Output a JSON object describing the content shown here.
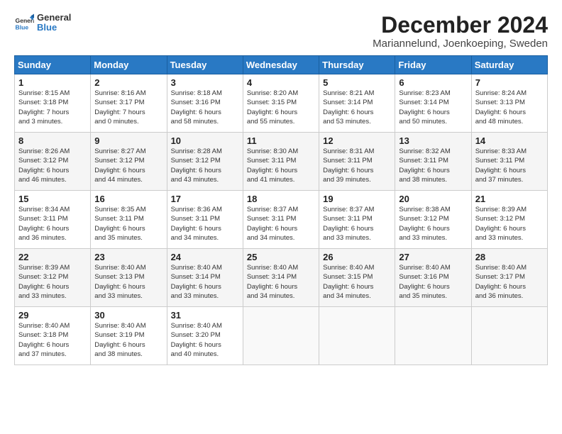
{
  "logo": {
    "line1": "General",
    "line2": "Blue"
  },
  "title": "December 2024",
  "subtitle": "Mariannelund, Joenkoeping, Sweden",
  "days_of_week": [
    "Sunday",
    "Monday",
    "Tuesday",
    "Wednesday",
    "Thursday",
    "Friday",
    "Saturday"
  ],
  "weeks": [
    [
      {
        "day": "1",
        "info": "Sunrise: 8:15 AM\nSunset: 3:18 PM\nDaylight: 7 hours\nand 3 minutes."
      },
      {
        "day": "2",
        "info": "Sunrise: 8:16 AM\nSunset: 3:17 PM\nDaylight: 7 hours\nand 0 minutes."
      },
      {
        "day": "3",
        "info": "Sunrise: 8:18 AM\nSunset: 3:16 PM\nDaylight: 6 hours\nand 58 minutes."
      },
      {
        "day": "4",
        "info": "Sunrise: 8:20 AM\nSunset: 3:15 PM\nDaylight: 6 hours\nand 55 minutes."
      },
      {
        "day": "5",
        "info": "Sunrise: 8:21 AM\nSunset: 3:14 PM\nDaylight: 6 hours\nand 53 minutes."
      },
      {
        "day": "6",
        "info": "Sunrise: 8:23 AM\nSunset: 3:14 PM\nDaylight: 6 hours\nand 50 minutes."
      },
      {
        "day": "7",
        "info": "Sunrise: 8:24 AM\nSunset: 3:13 PM\nDaylight: 6 hours\nand 48 minutes."
      }
    ],
    [
      {
        "day": "8",
        "info": "Sunrise: 8:26 AM\nSunset: 3:12 PM\nDaylight: 6 hours\nand 46 minutes."
      },
      {
        "day": "9",
        "info": "Sunrise: 8:27 AM\nSunset: 3:12 PM\nDaylight: 6 hours\nand 44 minutes."
      },
      {
        "day": "10",
        "info": "Sunrise: 8:28 AM\nSunset: 3:12 PM\nDaylight: 6 hours\nand 43 minutes."
      },
      {
        "day": "11",
        "info": "Sunrise: 8:30 AM\nSunset: 3:11 PM\nDaylight: 6 hours\nand 41 minutes."
      },
      {
        "day": "12",
        "info": "Sunrise: 8:31 AM\nSunset: 3:11 PM\nDaylight: 6 hours\nand 39 minutes."
      },
      {
        "day": "13",
        "info": "Sunrise: 8:32 AM\nSunset: 3:11 PM\nDaylight: 6 hours\nand 38 minutes."
      },
      {
        "day": "14",
        "info": "Sunrise: 8:33 AM\nSunset: 3:11 PM\nDaylight: 6 hours\nand 37 minutes."
      }
    ],
    [
      {
        "day": "15",
        "info": "Sunrise: 8:34 AM\nSunset: 3:11 PM\nDaylight: 6 hours\nand 36 minutes."
      },
      {
        "day": "16",
        "info": "Sunrise: 8:35 AM\nSunset: 3:11 PM\nDaylight: 6 hours\nand 35 minutes."
      },
      {
        "day": "17",
        "info": "Sunrise: 8:36 AM\nSunset: 3:11 PM\nDaylight: 6 hours\nand 34 minutes."
      },
      {
        "day": "18",
        "info": "Sunrise: 8:37 AM\nSunset: 3:11 PM\nDaylight: 6 hours\nand 34 minutes."
      },
      {
        "day": "19",
        "info": "Sunrise: 8:37 AM\nSunset: 3:11 PM\nDaylight: 6 hours\nand 33 minutes."
      },
      {
        "day": "20",
        "info": "Sunrise: 8:38 AM\nSunset: 3:12 PM\nDaylight: 6 hours\nand 33 minutes."
      },
      {
        "day": "21",
        "info": "Sunrise: 8:39 AM\nSunset: 3:12 PM\nDaylight: 6 hours\nand 33 minutes."
      }
    ],
    [
      {
        "day": "22",
        "info": "Sunrise: 8:39 AM\nSunset: 3:12 PM\nDaylight: 6 hours\nand 33 minutes."
      },
      {
        "day": "23",
        "info": "Sunrise: 8:40 AM\nSunset: 3:13 PM\nDaylight: 6 hours\nand 33 minutes."
      },
      {
        "day": "24",
        "info": "Sunrise: 8:40 AM\nSunset: 3:14 PM\nDaylight: 6 hours\nand 33 minutes."
      },
      {
        "day": "25",
        "info": "Sunrise: 8:40 AM\nSunset: 3:14 PM\nDaylight: 6 hours\nand 34 minutes."
      },
      {
        "day": "26",
        "info": "Sunrise: 8:40 AM\nSunset: 3:15 PM\nDaylight: 6 hours\nand 34 minutes."
      },
      {
        "day": "27",
        "info": "Sunrise: 8:40 AM\nSunset: 3:16 PM\nDaylight: 6 hours\nand 35 minutes."
      },
      {
        "day": "28",
        "info": "Sunrise: 8:40 AM\nSunset: 3:17 PM\nDaylight: 6 hours\nand 36 minutes."
      }
    ],
    [
      {
        "day": "29",
        "info": "Sunrise: 8:40 AM\nSunset: 3:18 PM\nDaylight: 6 hours\nand 37 minutes."
      },
      {
        "day": "30",
        "info": "Sunrise: 8:40 AM\nSunset: 3:19 PM\nDaylight: 6 hours\nand 38 minutes."
      },
      {
        "day": "31",
        "info": "Sunrise: 8:40 AM\nSunset: 3:20 PM\nDaylight: 6 hours\nand 40 minutes."
      },
      {
        "day": "",
        "info": ""
      },
      {
        "day": "",
        "info": ""
      },
      {
        "day": "",
        "info": ""
      },
      {
        "day": "",
        "info": ""
      }
    ]
  ]
}
